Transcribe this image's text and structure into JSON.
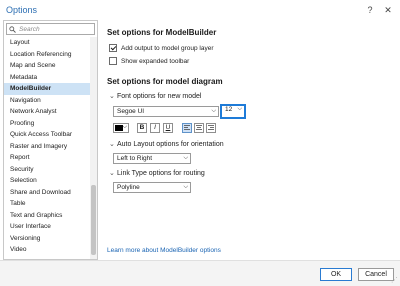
{
  "window": {
    "title": "Options",
    "help_symbol": "?",
    "close_symbol": "✕"
  },
  "sidebar": {
    "search_placeholder": "Search",
    "items": [
      {
        "label": "Layout"
      },
      {
        "label": "Location Referencing"
      },
      {
        "label": "Map and Scene"
      },
      {
        "label": "Metadata"
      },
      {
        "label": "ModelBuilder"
      },
      {
        "label": "Navigation"
      },
      {
        "label": "Network Analyst"
      },
      {
        "label": "Proofing"
      },
      {
        "label": "Quick Access Toolbar"
      },
      {
        "label": "Raster and Imagery"
      },
      {
        "label": "Report"
      },
      {
        "label": "Security"
      },
      {
        "label": "Selection"
      },
      {
        "label": "Share and Download"
      },
      {
        "label": "Table"
      },
      {
        "label": "Text and Graphics"
      },
      {
        "label": "User Interface"
      },
      {
        "label": "Versioning"
      },
      {
        "label": "Video"
      }
    ],
    "selected": "ModelBuilder"
  },
  "content": {
    "heading1": "Set options for ModelBuilder",
    "check_output_label": "Add output to model group layer",
    "check_output_checked": true,
    "check_toolbar_label": "Show expanded toolbar",
    "check_toolbar_checked": false,
    "heading2": "Set options for model diagram",
    "font_group_title": "Font options for new model",
    "font_name": "Segoe UI",
    "font_size": "12",
    "bold_label": "B",
    "italic_label": "I",
    "underline_label": "U",
    "layout_group_title": "Auto Layout options for orientation",
    "orientation_value": "Left to Right",
    "link_group_title": "Link Type options for routing",
    "routing_value": "Polyline",
    "learn_more_link": "Learn more about ModelBuilder options"
  },
  "footer": {
    "ok_label": "OK",
    "cancel_label": "Cancel"
  },
  "colors": {
    "accent": "#1e7bd8",
    "selected_bg": "#cde2f5",
    "link": "#1a64b3",
    "font_color": "#000000"
  }
}
